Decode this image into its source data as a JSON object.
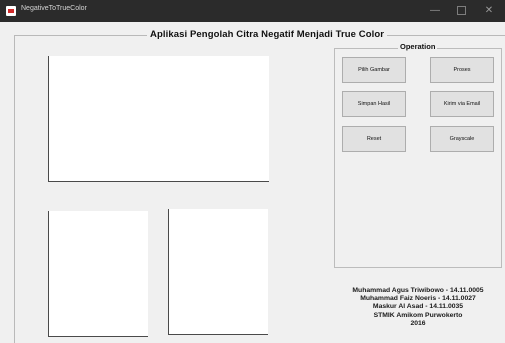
{
  "window": {
    "title": "NegativeToTrueColor",
    "minimize_glyph": "—",
    "close_glyph": "✕"
  },
  "app_title": "Aplikasi Pengolah Citra Negatif Menjadi True Color",
  "operation": {
    "title": "Operation",
    "buttons": {
      "pilih_gambar": "Pilih Gambar",
      "proses": "Proses",
      "simpan_hasil": "Simpan Hasil",
      "kirim_email": "Kirim via Email",
      "reset": "Reset",
      "grayscale": "Grayscale"
    }
  },
  "credits": [
    "Muhammad Agus Triwibowo - 14.11.0005",
    "Muhammad Faiz Noeris - 14.11.0027",
    "Maskur Al Asad - 14.11.0035",
    "STMIK Amikom Purwokerto",
    "2016"
  ],
  "colors": {
    "titlebar": "#2b2b2b",
    "window_bg": "#f0f0f0",
    "button_bg": "#e1e1e1",
    "pane_bg": "#ffffff"
  }
}
